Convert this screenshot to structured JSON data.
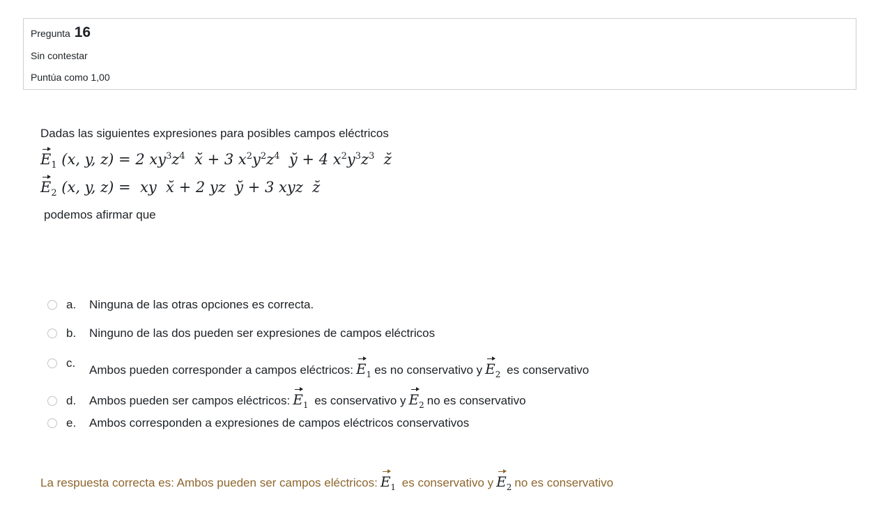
{
  "info": {
    "question_label": "Pregunta",
    "question_number": "16",
    "state": "Sin contestar",
    "grade": "Puntúa como 1,00"
  },
  "question": {
    "intro": "Dadas las siguientes expresiones para posibles campos eléctricos",
    "claim": "podemos afirmar que"
  },
  "options": [
    {
      "letter": "a.",
      "text": "Ninguna de las otras opciones es correcta."
    },
    {
      "letter": "b.",
      "text": "Ninguno de las dos pueden ser expresiones de campos eléctricos"
    },
    {
      "letter": "c.",
      "pre": "Ambos pueden corresponder a campos eléctricos:",
      "mid": "es no conservativo y",
      "post": "es conservativo"
    },
    {
      "letter": "d.",
      "pre": "Ambos pueden ser campos eléctricos:",
      "mid": "es conservativo y",
      "post": "no es conservativo"
    },
    {
      "letter": "e.",
      "text": "Ambos corresponden a expresiones de campos eléctricos conservativos"
    }
  ],
  "feedback": {
    "pre": "La respuesta correcta es: Ambos pueden ser campos eléctricos:",
    "mid": "es conservativo y",
    "post": "no es conservativo"
  },
  "colors": {
    "feedback": "#8e662e",
    "border": "#cfcfcf",
    "text": "#1d2125"
  }
}
